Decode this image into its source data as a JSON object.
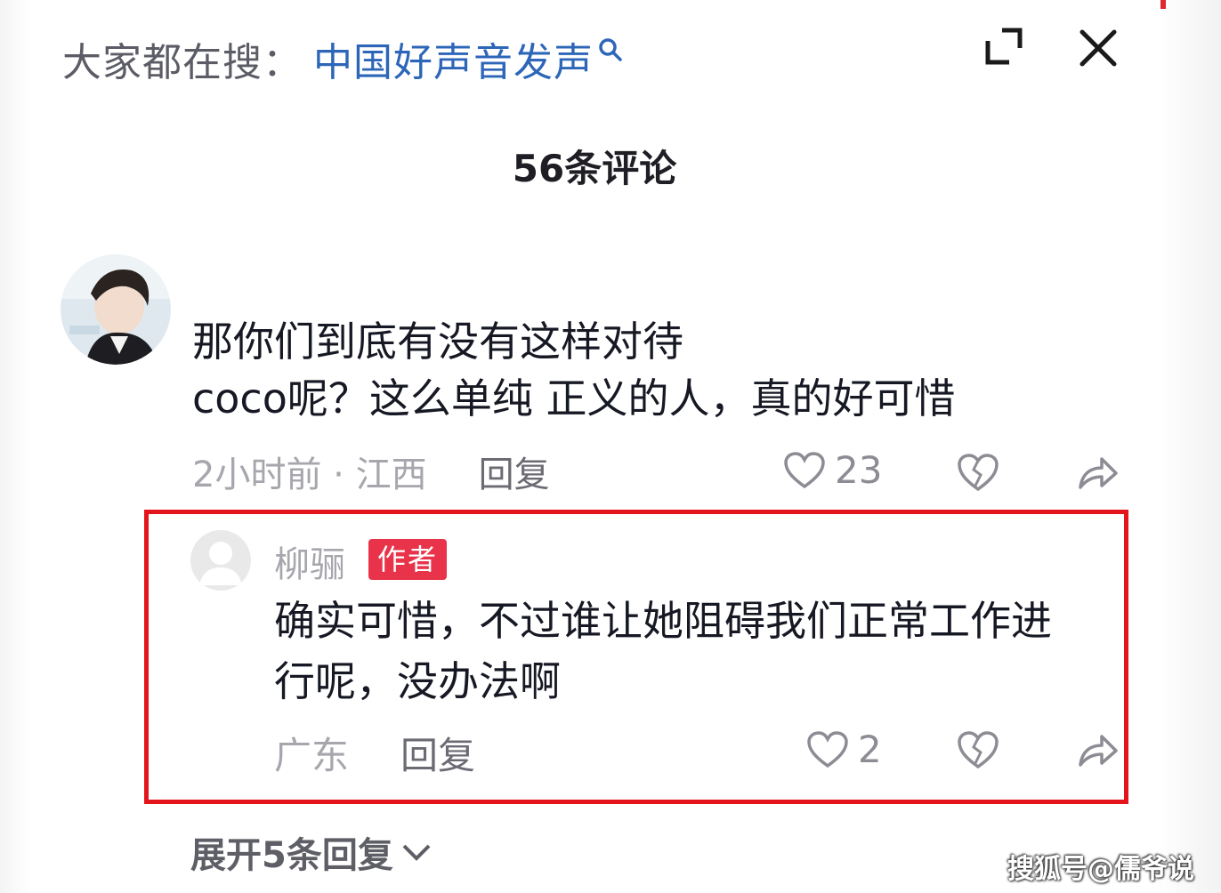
{
  "header": {
    "search_prefix": "大家都在搜：",
    "search_term": "中国好声音发声",
    "icons": [
      "search-icon",
      "expand-icon",
      "close-icon"
    ]
  },
  "comment_count": "56条评论",
  "comments": [
    {
      "text_line1": "那你们到底有没有这样对待",
      "text_line2": "coco呢？这么单纯 正义的人，真的好可惜",
      "meta": "2小时前 · 江西",
      "reply_label": "回复",
      "likes": "23"
    }
  ],
  "reply": {
    "username": "柳骊",
    "badge": "作者",
    "text_line1": "确实可惜，不过谁让她阻碍我们正常工作进",
    "text_line2": "行呢，没办法啊",
    "location": "广东",
    "reply_label": "回复",
    "likes": "2"
  },
  "expand_replies": "展开5条回复",
  "watermark": "搜狐号@儒爷说",
  "colors": {
    "link_blue": "#2d66b8",
    "badge_red": "#e8334a",
    "highlight_red": "#e3141b",
    "meta_gray": "#a6a6ad"
  }
}
